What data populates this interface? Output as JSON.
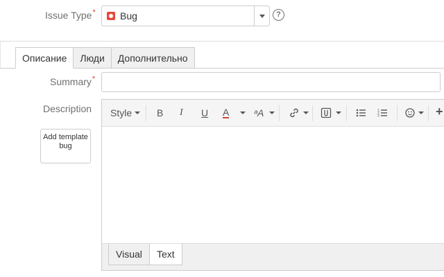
{
  "issue_type": {
    "label": "Issue Type",
    "required_mark": "*",
    "value": "Bug",
    "icon": "bug-icon",
    "help_icon": "question-circle-icon"
  },
  "tabs": [
    {
      "label": "Описание",
      "active": true
    },
    {
      "label": "Люди",
      "active": false
    },
    {
      "label": "Дополнительно",
      "active": false
    }
  ],
  "summary": {
    "label": "Summary",
    "required_mark": "*",
    "value": ""
  },
  "description": {
    "label": "Description",
    "template_button": "Add template bug"
  },
  "toolbar": {
    "style_label": "Style",
    "bold": "B",
    "italic": "I",
    "underline": "U",
    "text_color": "A",
    "more_formatting": "ᵃA",
    "link_icon": "link-icon",
    "attachment_icon": "paperclip-icon",
    "bullet_list_icon": "bullet-list-icon",
    "numbered_list_icon": "numbered-list-icon",
    "emoji_icon": "emoji-icon",
    "insert_icon": "plus-icon"
  },
  "editor_modes": [
    {
      "label": "Visual",
      "active": false
    },
    {
      "label": "Text",
      "active": true
    }
  ],
  "colors": {
    "required": "#d04437",
    "bug": "#e5493a",
    "text_color_underline": "#d04437"
  }
}
